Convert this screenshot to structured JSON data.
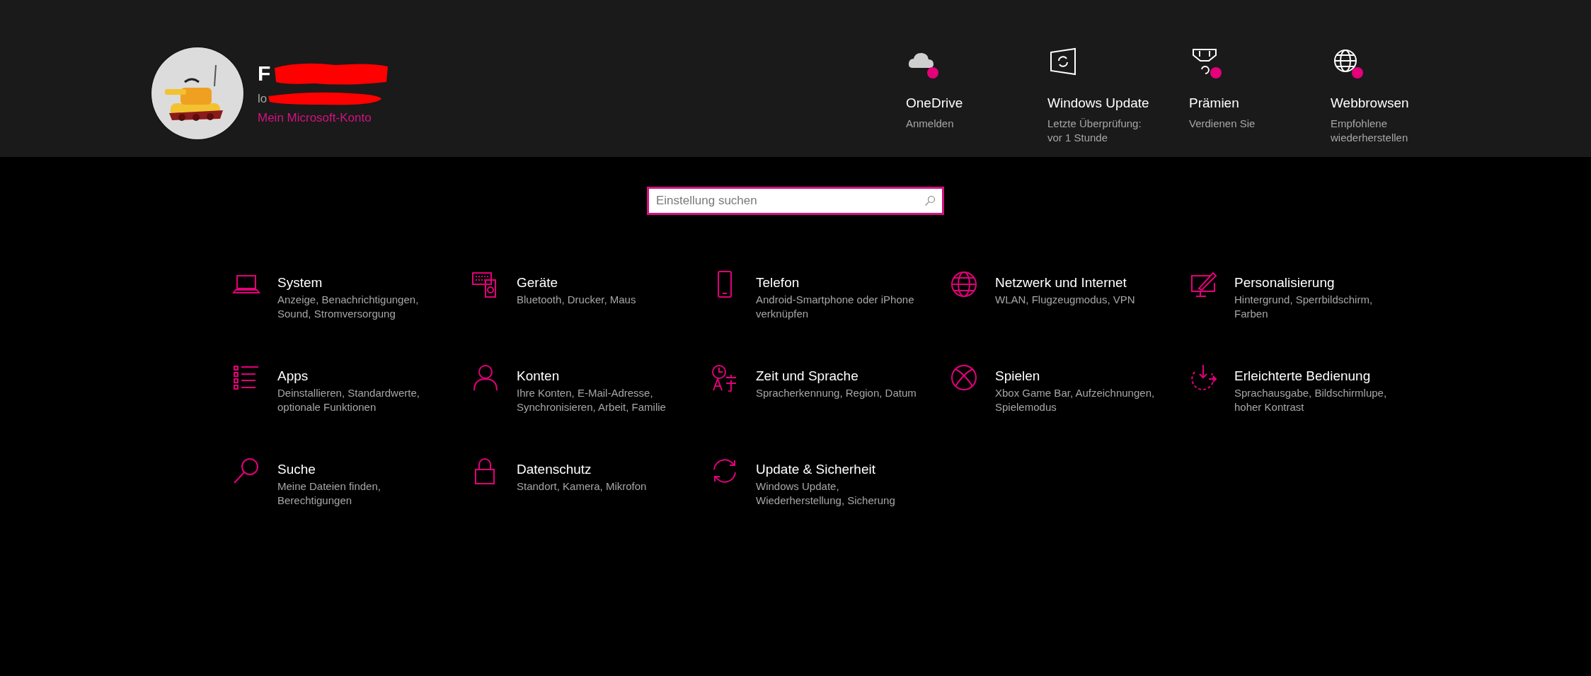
{
  "account": {
    "name": "F",
    "email": "lo",
    "link": "Mein Microsoft-Konto"
  },
  "quick_links": [
    {
      "title": "OneDrive",
      "subtitle": "Anmelden",
      "badge": true
    },
    {
      "title": "Windows Update",
      "subtitle": "Letzte Überprüfung: vor 1 Stunde",
      "badge": false
    },
    {
      "title": "Prämien",
      "subtitle": "Verdienen Sie",
      "badge": true
    },
    {
      "title": "Webbrowsen",
      "subtitle": "Empfohlene wiederherstellen",
      "badge": true
    }
  ],
  "search": {
    "placeholder": "Einstellung suchen"
  },
  "categories": [
    {
      "title": "System",
      "subtitle": "Anzeige, Benachrichtigungen, Sound, Stromversorgung"
    },
    {
      "title": "Geräte",
      "subtitle": "Bluetooth, Drucker, Maus"
    },
    {
      "title": "Telefon",
      "subtitle": "Android-Smartphone oder iPhone verknüpfen"
    },
    {
      "title": "Netzwerk und Internet",
      "subtitle": "WLAN, Flugzeugmodus, VPN"
    },
    {
      "title": "Personalisierung",
      "subtitle": "Hintergrund, Sperrbildschirm, Farben"
    },
    {
      "title": "Apps",
      "subtitle": "Deinstallieren, Standardwerte, optionale Funktionen"
    },
    {
      "title": "Konten",
      "subtitle": "Ihre Konten, E-Mail-Adresse, Synchronisieren, Arbeit, Familie"
    },
    {
      "title": "Zeit und Sprache",
      "subtitle": "Spracherkennung, Region, Datum"
    },
    {
      "title": "Spielen",
      "subtitle": "Xbox Game Bar, Aufzeichnungen, Spielemodus"
    },
    {
      "title": "Erleichterte Bedienung",
      "subtitle": "Sprachausgabe, Bildschirmlupe, hoher Kontrast"
    },
    {
      "title": "Suche",
      "subtitle": "Meine Dateien finden, Berechtigungen"
    },
    {
      "title": "Datenschutz",
      "subtitle": "Standort, Kamera, Mikrofon"
    },
    {
      "title": "Update & Sicherheit",
      "subtitle": "Windows Update, Wiederherstellung, Sicherung"
    }
  ]
}
